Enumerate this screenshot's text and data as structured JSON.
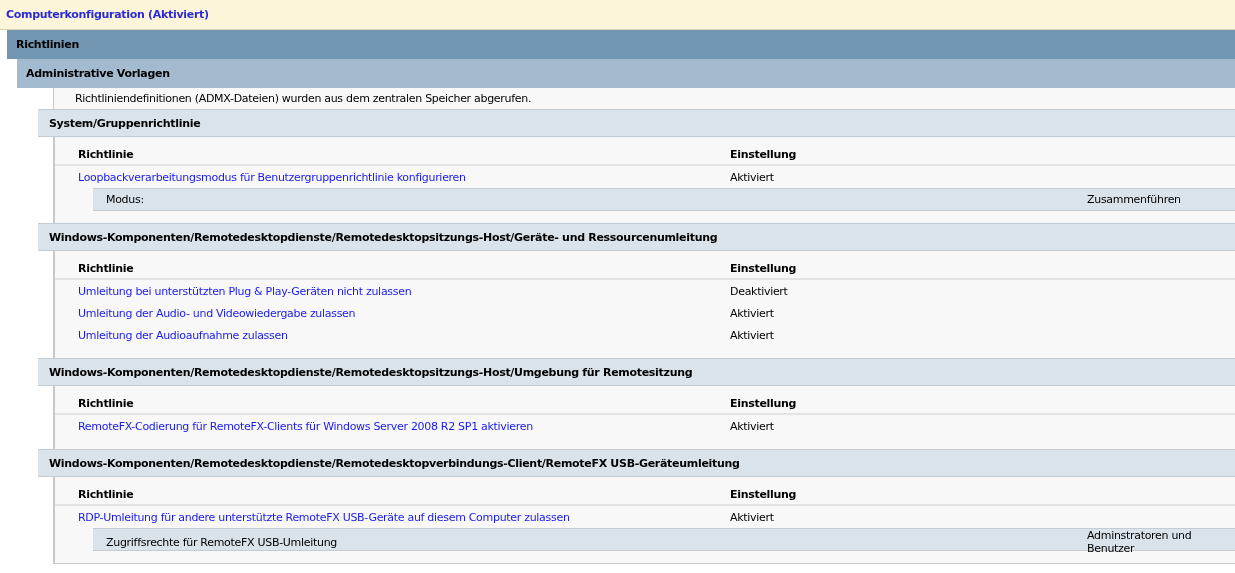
{
  "title": "Computerkonfiguration (Aktiviert)",
  "level1": "Richtlinien",
  "level2": "Administrative Vorlagen",
  "note": "Richtliniendefinitionen (ADMX-Dateien) wurden aus dem zentralen Speicher abgerufen.",
  "sections": [
    {
      "title": "System/Gruppenrichtlinie",
      "columns": [
        "Richtlinie",
        "Einstellung"
      ],
      "rows": [
        {
          "policy": "Loopbackverarbeitungsmodus für Benutzergruppenrichtlinie konfigurieren",
          "setting": "Aktiviert",
          "options": [
            {
              "label": "Modus:",
              "value": "Zusammenführen"
            }
          ]
        }
      ]
    },
    {
      "title": "Windows-Komponenten/Remotedesktopdienste/Remotedesktopsitzungs-Host/Geräte- und Ressourcenumleitung",
      "columns": [
        "Richtlinie",
        "Einstellung"
      ],
      "rows": [
        {
          "policy": "Umleitung bei unterstützten Plug & Play-Geräten nicht zulassen",
          "setting": "Deaktiviert"
        },
        {
          "policy": "Umleitung der Audio- und Videowiedergabe zulassen",
          "setting": "Aktiviert"
        },
        {
          "policy": "Umleitung der Audioaufnahme zulassen",
          "setting": "Aktiviert"
        }
      ]
    },
    {
      "title": "Windows-Komponenten/Remotedesktopdienste/Remotedesktopsitzungs-Host/Umgebung für Remotesitzung",
      "columns": [
        "Richtlinie",
        "Einstellung"
      ],
      "rows": [
        {
          "policy": "RemoteFX-Codierung für RemoteFX-Clients für Windows Server 2008 R2 SP1 aktivieren",
          "setting": "Aktiviert"
        }
      ]
    },
    {
      "title": "Windows-Komponenten/Remotedesktopdienste/Remotedesktopverbindungs-Client/RemoteFX USB-Geräteumleitung",
      "columns": [
        "Richtlinie",
        "Einstellung"
      ],
      "rows": [
        {
          "policy": "RDP-Umleitung für andere unterstützte RemoteFX USB-Geräte auf diesem Computer zulassen",
          "setting": "Aktiviert",
          "options": [
            {
              "label": "Zugriffsrechte für RemoteFX USB-Umleitung",
              "value": "Adminstratoren und Benutzer"
            }
          ]
        }
      ]
    }
  ]
}
